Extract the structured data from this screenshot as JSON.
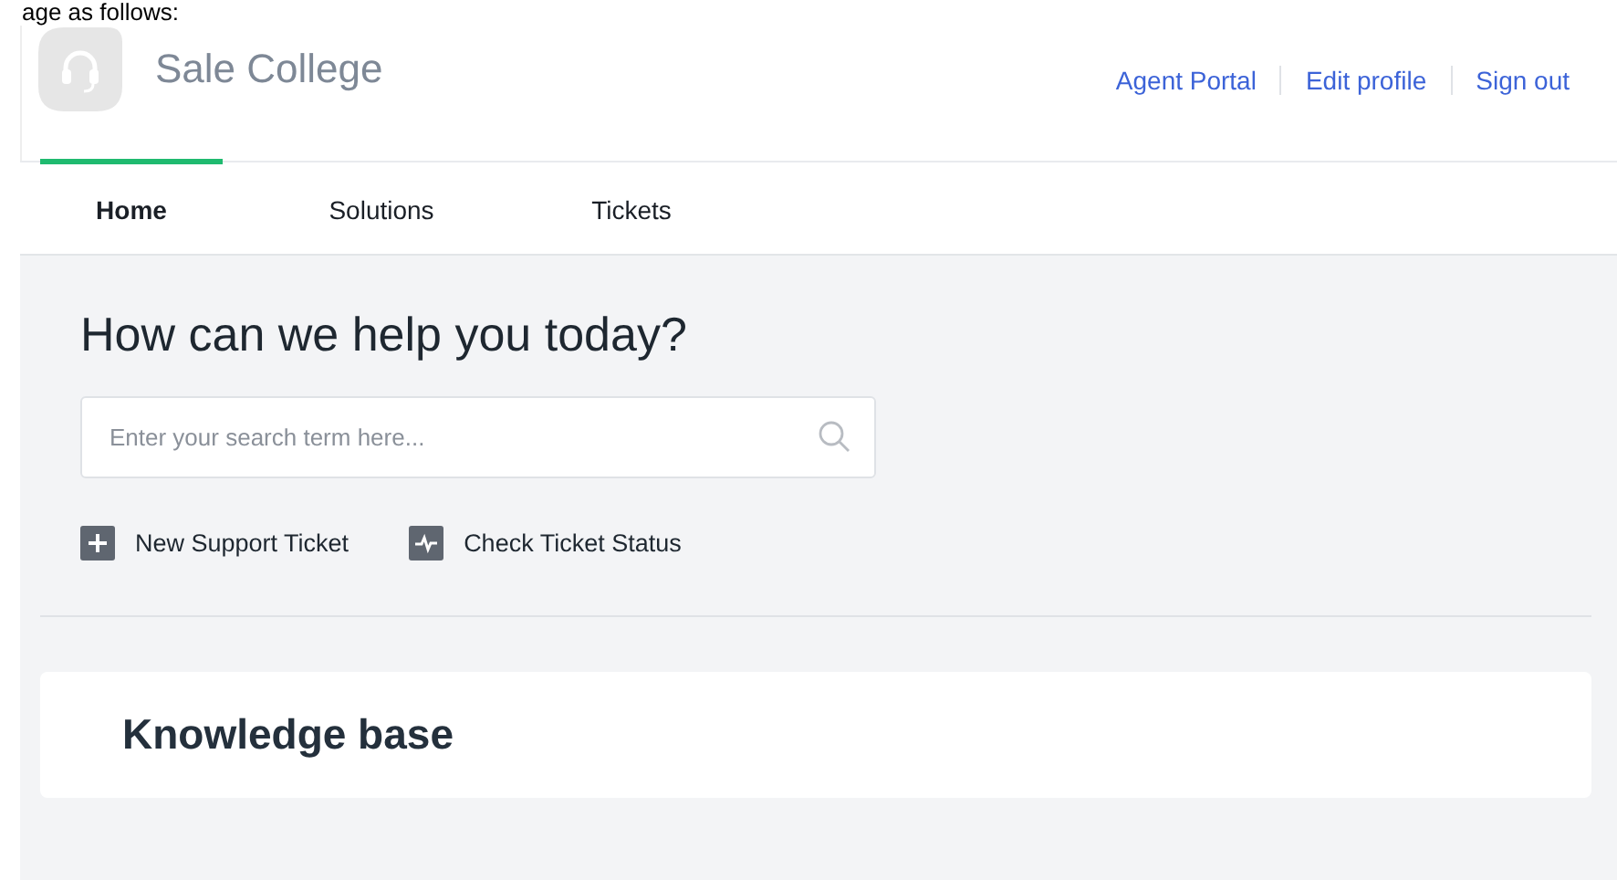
{
  "document_text": "age as follows:",
  "header": {
    "site_name": "Sale College",
    "links": [
      {
        "label": "Agent Portal"
      },
      {
        "label": "Edit profile"
      },
      {
        "label": "Sign out"
      }
    ]
  },
  "tabs": [
    {
      "label": "Home",
      "selected": true
    },
    {
      "label": "Solutions",
      "selected": false
    },
    {
      "label": "Tickets",
      "selected": false
    }
  ],
  "hero": {
    "title": "How can we help you today?",
    "search": {
      "placeholder": "Enter your search term here..."
    },
    "actions": [
      {
        "kind": "plus",
        "label": "New Support Ticket"
      },
      {
        "kind": "pulse",
        "label": "Check Ticket Status"
      }
    ]
  },
  "knowledge_base": {
    "title": "Knowledge base"
  }
}
